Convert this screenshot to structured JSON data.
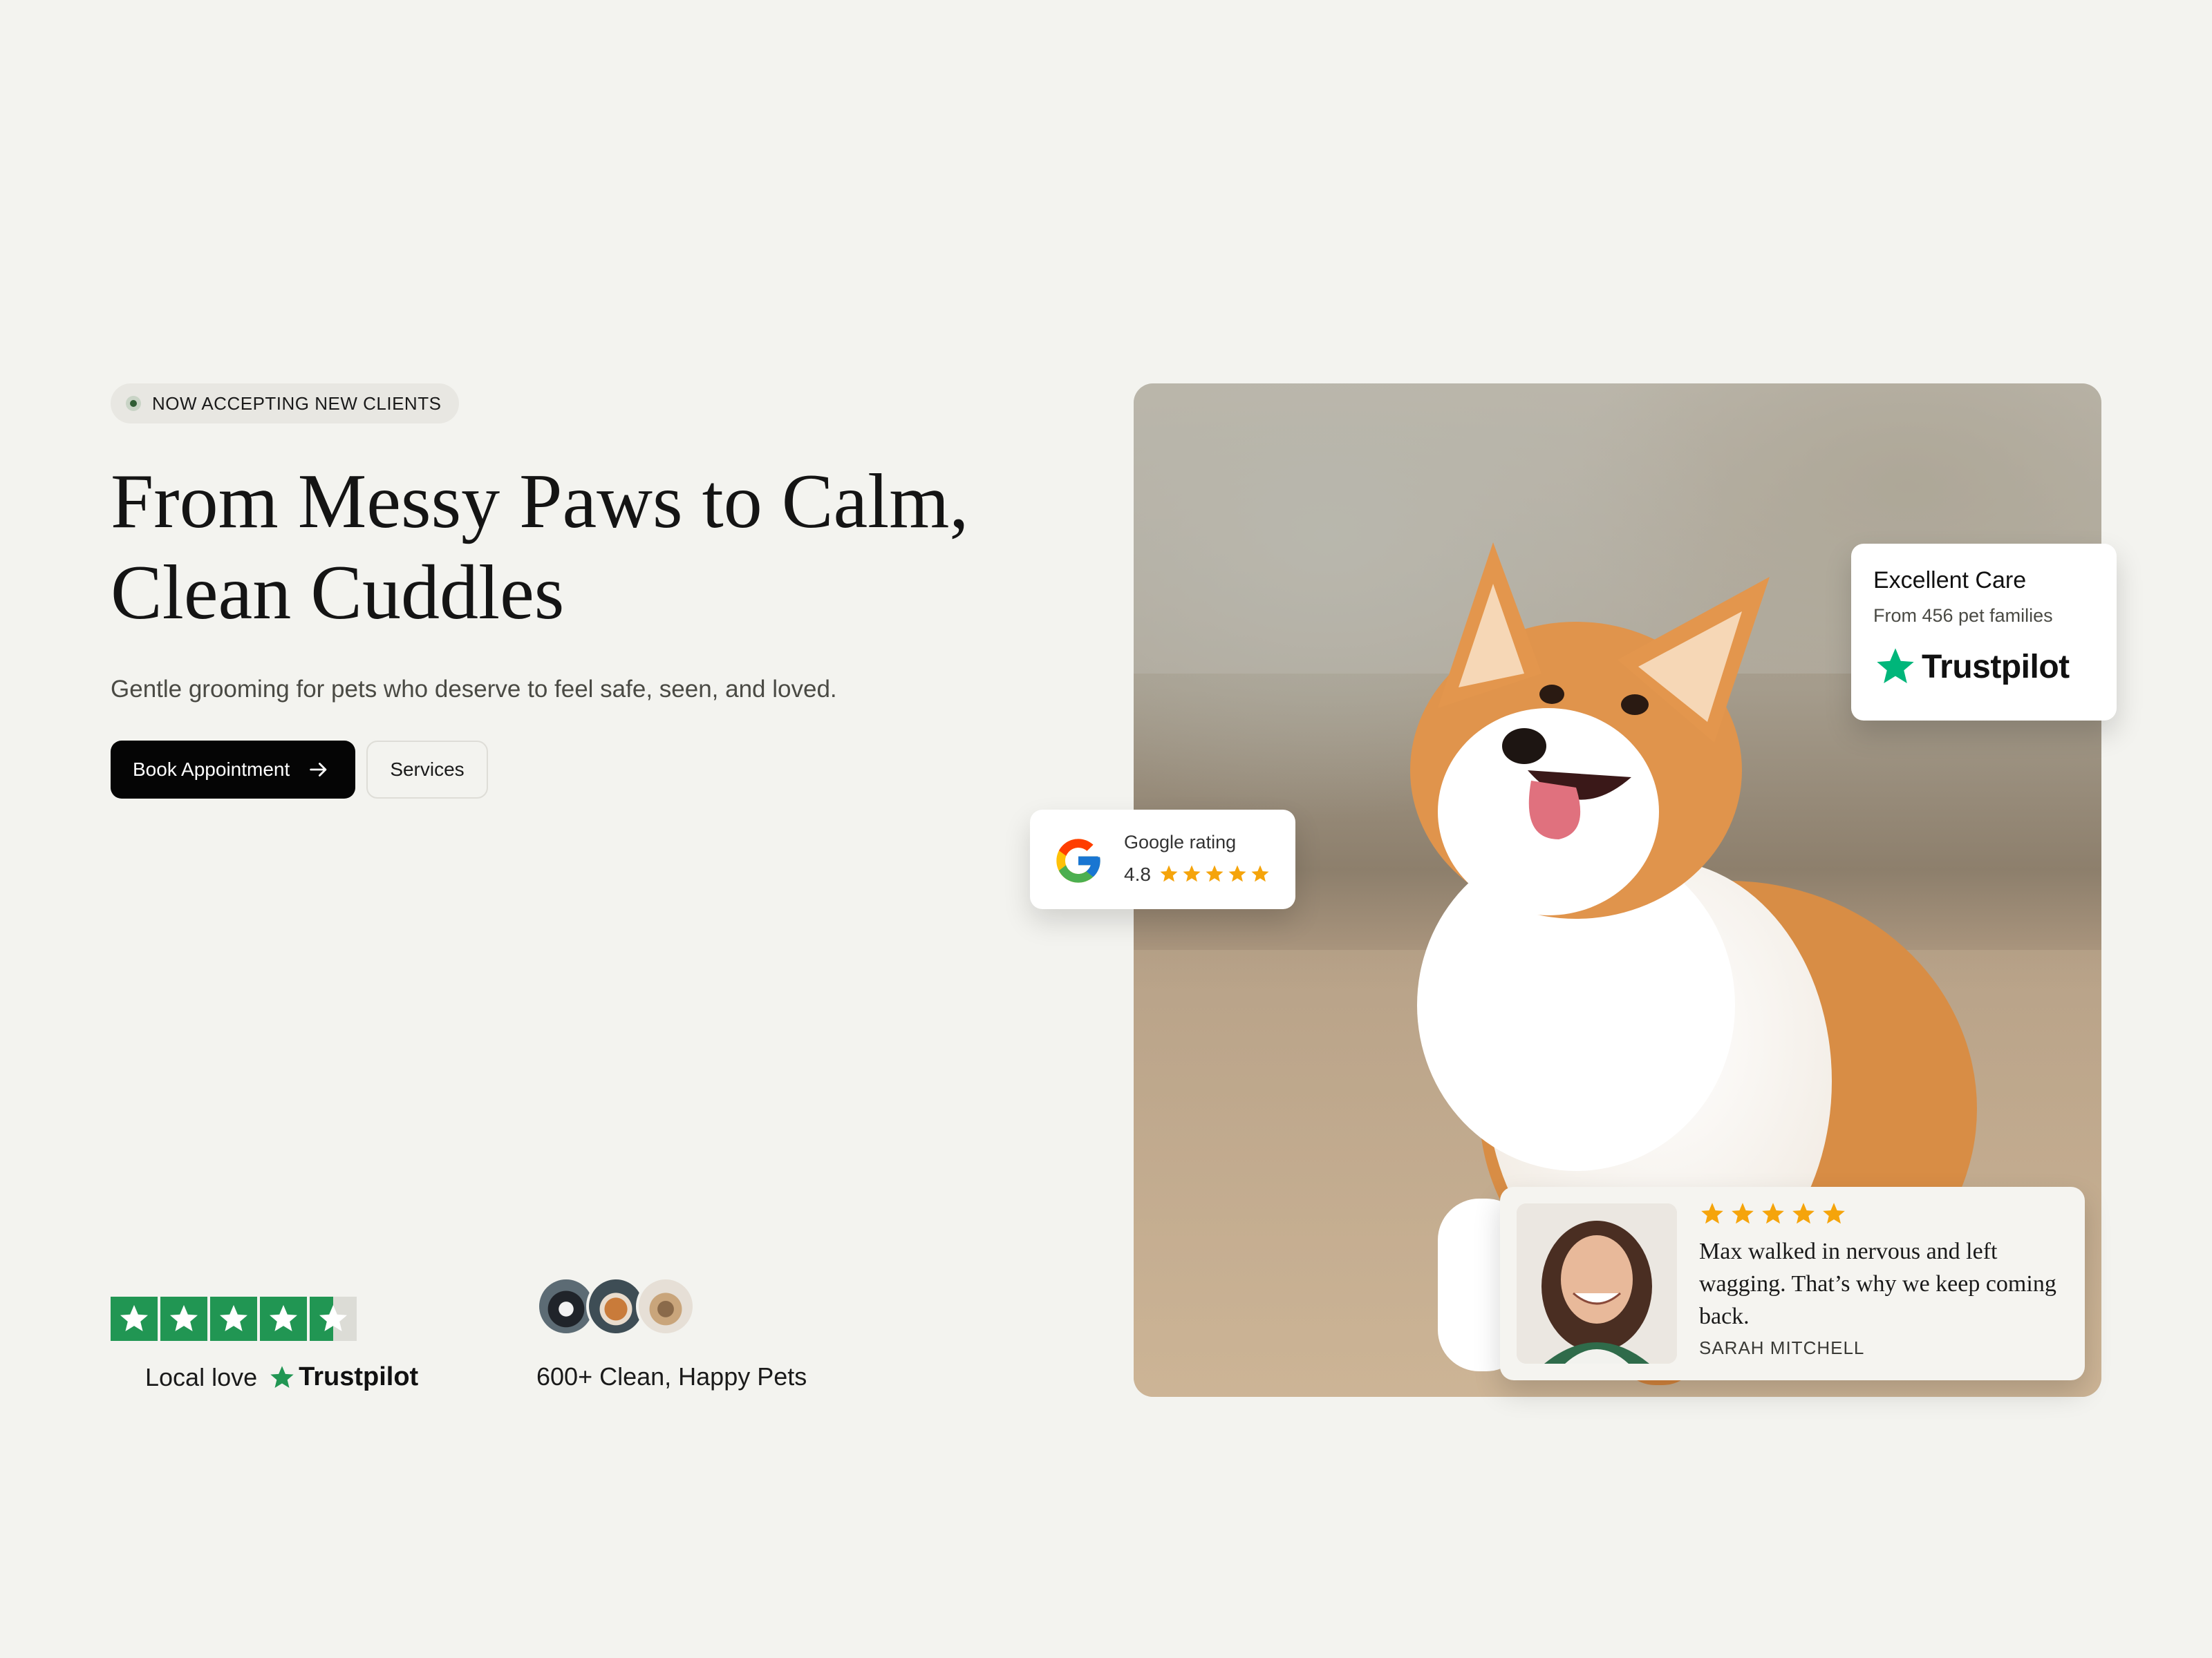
{
  "badge": {
    "label": "NOW ACCEPTING NEW CLIENTS"
  },
  "hero": {
    "headline_line1": "From Messy Paws to Calm,",
    "headline_line2": "Clean Cuddles",
    "subheadline": "Gentle grooming for pets who deserve to feel safe, seen, and loved."
  },
  "buttons": {
    "primary_label": "Book Appointment",
    "secondary_label": "Services"
  },
  "social_proof": {
    "trustpilot_rating_stars": 4.5,
    "local_love_label": "Local love",
    "trustpilot_brand": "Trustpilot",
    "pets_count_label": "600+ Clean, Happy Pets"
  },
  "trust_card": {
    "title": "Excellent Care",
    "subtitle": "From 456 pet families",
    "brand": "Trustpilot"
  },
  "google_card": {
    "label": "Google rating",
    "rating": "4.8",
    "stars": 5
  },
  "review_card": {
    "stars": 5,
    "quote": "Max walked in nervous and left wagging. That’s why we keep coming back.",
    "author": "SARAH MITCHELL"
  },
  "colors": {
    "background": "#f3f3ef",
    "primary_button": "#050505",
    "trustpilot_green": "#219653",
    "trustpilot_star": "#00b67a",
    "star_gold": "#f5a40b"
  },
  "icons": [
    "status-dot-icon",
    "arrow-right-icon",
    "trustpilot-star-icon",
    "google-g-icon",
    "star-icon"
  ]
}
